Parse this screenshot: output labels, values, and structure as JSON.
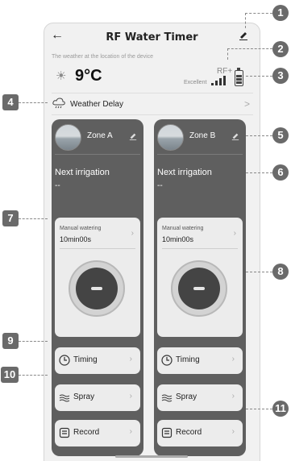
{
  "header": {
    "title": "RF Water Timer",
    "back_icon": "back-arrow-icon",
    "edit_icon": "edit-pencil-icon"
  },
  "weather": {
    "note": "The weather at the location of the device",
    "temperature": "9°C"
  },
  "device": {
    "rf_label": "RF+",
    "signal_label": "Excellent",
    "signal_bars": 4
  },
  "weather_delay": {
    "label": "Weather Delay",
    "arrow": ">"
  },
  "zones": [
    {
      "name": "Zone A",
      "next_label": "Next irrigation",
      "next_value": "--",
      "manual_label": "Manual watering",
      "manual_value": "10min00s",
      "timing": "Timing",
      "spray": "Spray",
      "record": "Record"
    },
    {
      "name": "Zone B",
      "next_label": "Next irrigation",
      "next_value": "--",
      "manual_label": "Manual watering",
      "manual_value": "10min00s",
      "timing": "Timing",
      "spray": "Spray",
      "record": "Record"
    }
  ],
  "callouts": [
    "1",
    "2",
    "3",
    "4",
    "5",
    "6",
    "7",
    "8",
    "9",
    "10",
    "11"
  ],
  "colors": {
    "zone_card": "#5f5f5f",
    "callout": "#6a6a6a",
    "background": "#f1f1f1"
  }
}
